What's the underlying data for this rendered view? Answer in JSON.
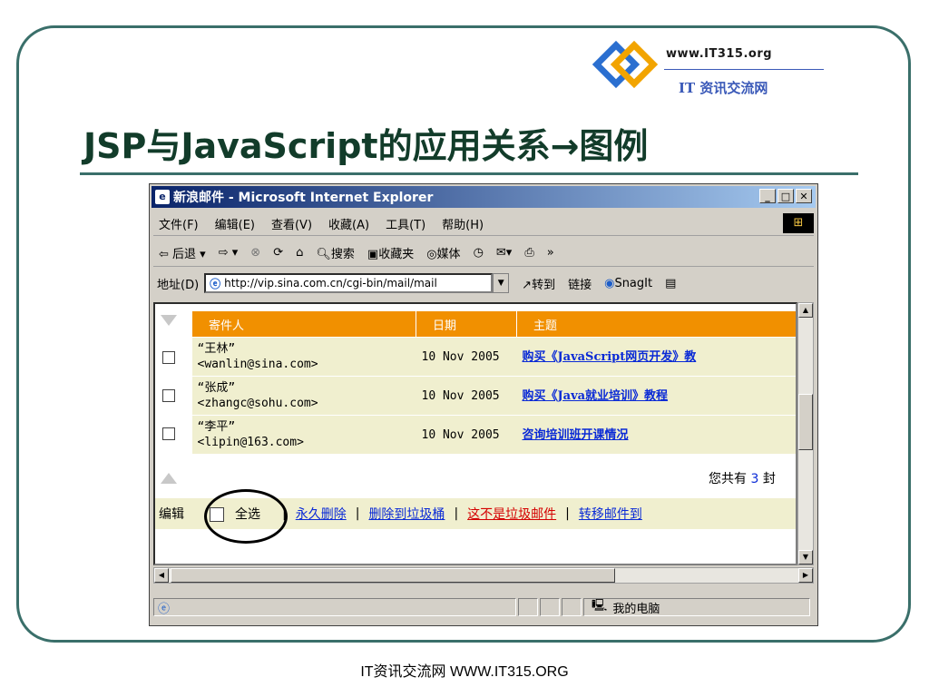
{
  "logo": {
    "top": "www.IT315.org",
    "bottom": "IT 资讯交流网"
  },
  "slide": {
    "title": "JSP与JavaScript的应用关系→图例",
    "footer": "IT资讯交流网 WWW.IT315.ORG"
  },
  "ie": {
    "title": "新浪邮件 - Microsoft Internet Explorer",
    "menu": [
      "文件(F)",
      "编辑(E)",
      "查看(V)",
      "收藏(A)",
      "工具(T)",
      "帮助(H)"
    ],
    "toolbar": {
      "back": "⇦ 后退",
      "forward": "⇨",
      "search": "搜索",
      "favorites": "收藏夹",
      "media": "媒体",
      "more": "»"
    },
    "address": {
      "label": "地址(D)",
      "url": "http://vip.sina.com.cn/cgi-bin/mail/mail",
      "go": "转到",
      "links": "链接",
      "snagit": "SnagIt"
    },
    "status": {
      "zone": "我的电脑"
    }
  },
  "mail": {
    "columns": [
      "寄件人",
      "日期",
      "主题"
    ],
    "rows": [
      {
        "name": "“王林”",
        "email": "<wanlin@sina.com>",
        "date": "10 Nov 2005",
        "subject": "购买《JavaScript网页开发》教"
      },
      {
        "name": "“张成”",
        "email": "<zhangc@sohu.com>",
        "date": "10 Nov 2005",
        "subject": "购买《Java就业培训》教程"
      },
      {
        "name": "“李平”",
        "email": "<lipin@163.com>",
        "date": "10 Nov 2005",
        "subject": "咨询培训班开课情况"
      }
    ],
    "total_prefix": "您共有",
    "total_count": "3",
    "total_suffix": "封",
    "actions": {
      "label": "编辑",
      "select_all": "全选",
      "delete_forever": "永久删除",
      "to_trash": "删除到垃圾桶",
      "not_spam": "这不是垃圾邮件",
      "move": "转移邮件到"
    }
  }
}
